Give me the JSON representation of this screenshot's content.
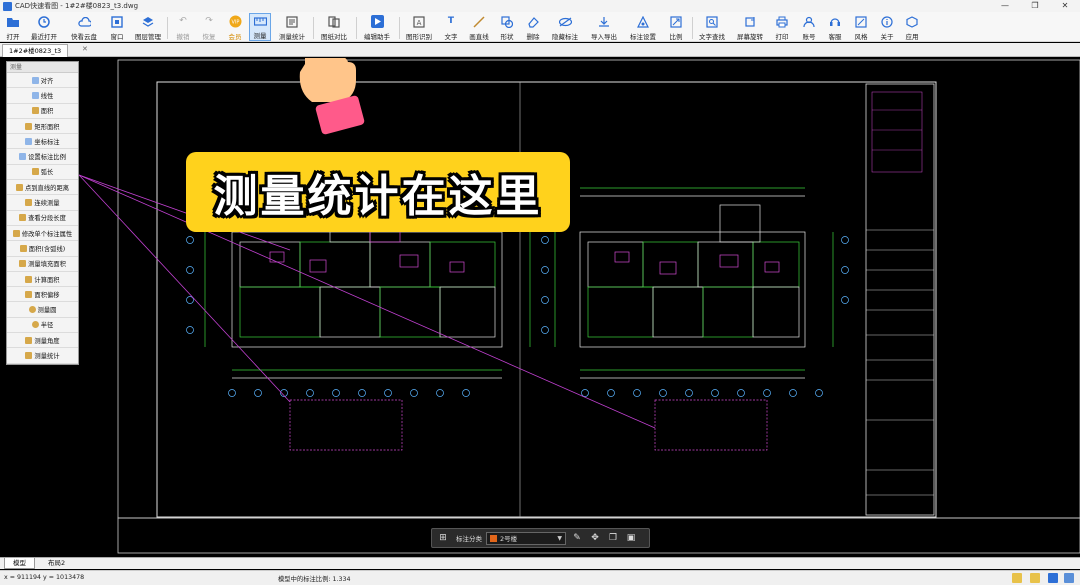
{
  "window": {
    "title": "CAD快速看图 - 1#2#楼0823_t3.dwg"
  },
  "toolbar": {
    "items": [
      {
        "label": "打开",
        "icon": "folder-icon"
      },
      {
        "label": "最近打开",
        "icon": "clock-icon"
      },
      {
        "label": "快看云盘",
        "icon": "cloud-icon"
      },
      {
        "label": "窗口",
        "icon": "window-icon"
      },
      {
        "label": "图层管理",
        "icon": "layers-icon"
      },
      {
        "label": "撤销",
        "icon": "undo-icon"
      },
      {
        "label": "恢复",
        "icon": "redo-icon"
      },
      {
        "label": "会员",
        "icon": "vip-icon"
      },
      {
        "label": "测量",
        "icon": "ruler-icon"
      },
      {
        "label": "测量统计",
        "icon": "measure-stats-icon"
      },
      {
        "label": "图纸对比",
        "icon": "compare-icon"
      },
      {
        "label": "编辑助手",
        "icon": "edit-assist-icon"
      },
      {
        "label": "图形识别",
        "icon": "shape-recognize-icon"
      },
      {
        "label": "文字",
        "icon": "text-icon"
      },
      {
        "label": "画直线",
        "icon": "line-icon"
      },
      {
        "label": "形状",
        "icon": "shape-icon"
      },
      {
        "label": "删除",
        "icon": "eraser-icon"
      },
      {
        "label": "隐藏标注",
        "icon": "hide-icon"
      },
      {
        "label": "导入导出",
        "icon": "import-export-icon"
      },
      {
        "label": "标注设置",
        "icon": "annotation-settings-icon"
      },
      {
        "label": "比例",
        "icon": "scale-icon"
      },
      {
        "label": "文字查找",
        "icon": "text-search-icon"
      },
      {
        "label": "屏幕旋转",
        "icon": "rotate-icon"
      },
      {
        "label": "打印",
        "icon": "print-icon"
      },
      {
        "label": "账号",
        "icon": "account-icon"
      },
      {
        "label": "客服",
        "icon": "headset-icon"
      },
      {
        "label": "风格",
        "icon": "style-icon"
      },
      {
        "label": "关于",
        "icon": "info-icon"
      },
      {
        "label": "应用",
        "icon": "apps-icon"
      }
    ]
  },
  "tabs": {
    "document": "1#2#楼0823_t3"
  },
  "measure_panel": {
    "title": "测量",
    "items": [
      "对齐",
      "线性",
      "面积",
      "矩形面积",
      "坐标标注",
      "设置标注比例",
      "弧长",
      "点到直线的距离",
      "连续测量",
      "查看分段长度",
      "修改单个标注属性",
      "面积(含弧线)",
      "测量填充面积",
      "计算面积",
      "面积偏移",
      "测量圆",
      "半径",
      "测量角度",
      "测量统计"
    ]
  },
  "callout": {
    "text": "测量统计在这里"
  },
  "annotation_bar": {
    "label": "标注分类",
    "selected": "2号楼",
    "swatch_color": "#e2661a"
  },
  "layout_tabs": [
    "模型",
    "布局2"
  ],
  "status": {
    "coords": "x = 911194  y = 1013478",
    "ratio": "模型中的标注比例: 1.334"
  }
}
